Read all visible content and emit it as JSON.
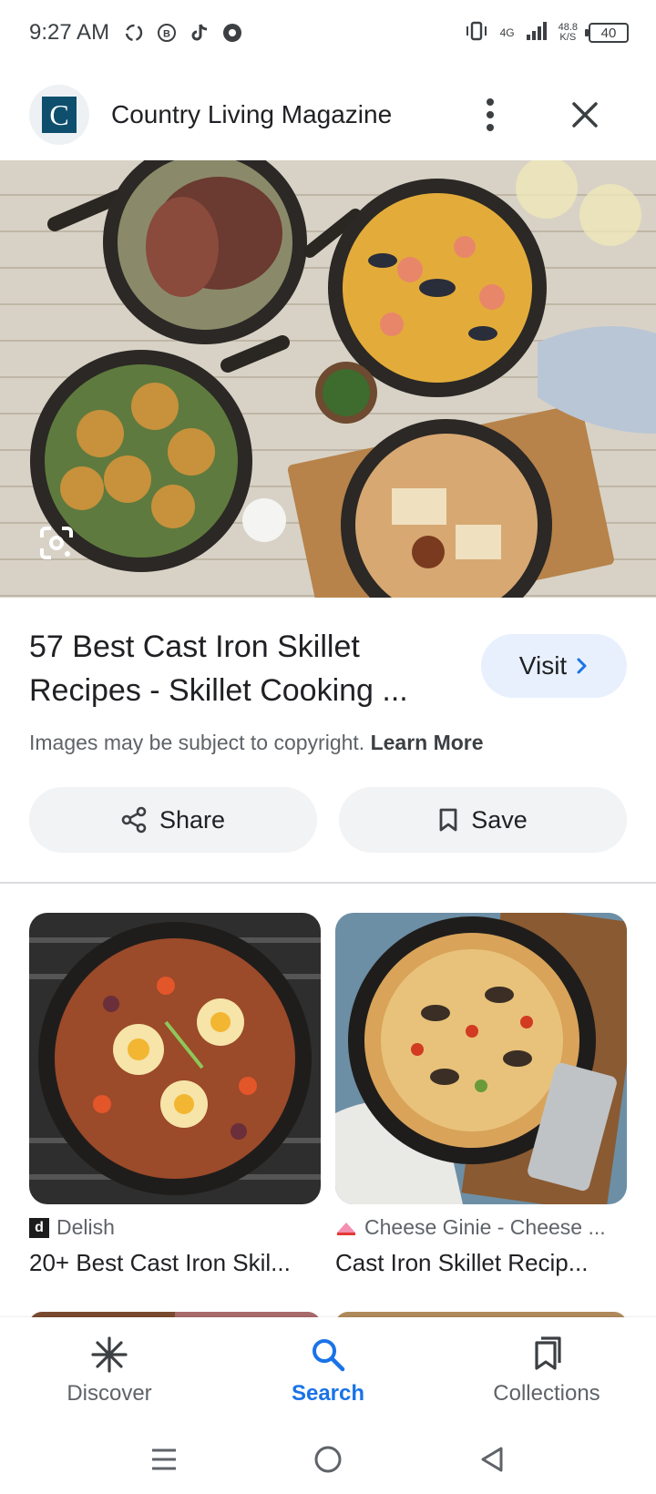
{
  "status_bar": {
    "time": "9:27 AM",
    "network_type": "4G",
    "speed_value": "48.8",
    "speed_unit": "K/S",
    "battery": "40"
  },
  "header": {
    "site_logo_letter": "C",
    "site_name": "Country Living Magazine"
  },
  "result": {
    "title": "57 Best Cast Iron Skillet Recipes - Skillet Cooking ...",
    "visit_label": "Visit",
    "copyright_text": "Images may be subject to copyright.",
    "learn_more": "Learn More",
    "share_label": "Share",
    "save_label": "Save"
  },
  "related": [
    {
      "source_icon_letter": "d",
      "source": "Delish",
      "title": "20+ Best Cast Iron Skil..."
    },
    {
      "source": "Cheese Ginie - Cheese ...",
      "title": "Cast Iron Skillet Recip..."
    }
  ],
  "bottom_nav": {
    "items": [
      {
        "label": "Discover",
        "icon": "asterisk-icon"
      },
      {
        "label": "Search",
        "icon": "search-icon",
        "active": true
      },
      {
        "label": "Collections",
        "icon": "collections-icon"
      }
    ]
  },
  "colors": {
    "accent": "#1a73e8",
    "visit_bg": "#e8f0fe",
    "chip_bg": "#f1f3f4"
  }
}
